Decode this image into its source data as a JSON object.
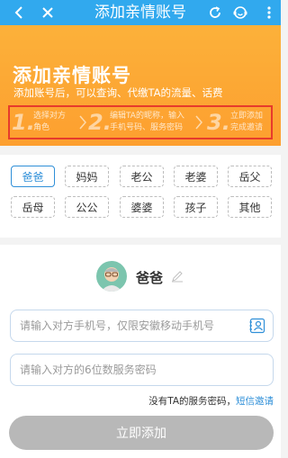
{
  "header": {
    "title": "添加亲情账号",
    "icons": [
      "back-icon",
      "close-icon",
      "refresh-icon",
      "customer-service-icon",
      "more-icon"
    ]
  },
  "hero": {
    "title": "添加亲情账号",
    "subtitle": "添加账号后，可以查询、代缴TA的流量、话费",
    "steps": [
      {
        "num": "1.",
        "line1": "选择对方",
        "line2": "角色"
      },
      {
        "num": "2.",
        "line1": "编辑TA的昵称，输入",
        "line2": "手机号码、服务密码"
      },
      {
        "num": "3.",
        "line1": "立即添加",
        "line2": "完成邀请"
      }
    ],
    "colors": {
      "bg": "#fdab35",
      "highlight_border": "#e73b2c"
    }
  },
  "relations": {
    "selected": "爸爸",
    "items": [
      "爸爸",
      "妈妈",
      "老公",
      "老婆",
      "岳父",
      "岳母",
      "公公",
      "婆婆",
      "孩子",
      "其他"
    ]
  },
  "form": {
    "name": "爸爸",
    "phone_placeholder": "请输入对方手机号，仅限安徽移动手机号",
    "password_placeholder": "请输入对方的6位数服务密码",
    "hint_text": "没有TA的服务密码，",
    "hint_link": "短信邀请",
    "submit_label": "立即添加"
  },
  "colors": {
    "accent": "#2f8fd8",
    "topbar": "#31a9ee",
    "button_disabled": "#b8b8b8"
  }
}
